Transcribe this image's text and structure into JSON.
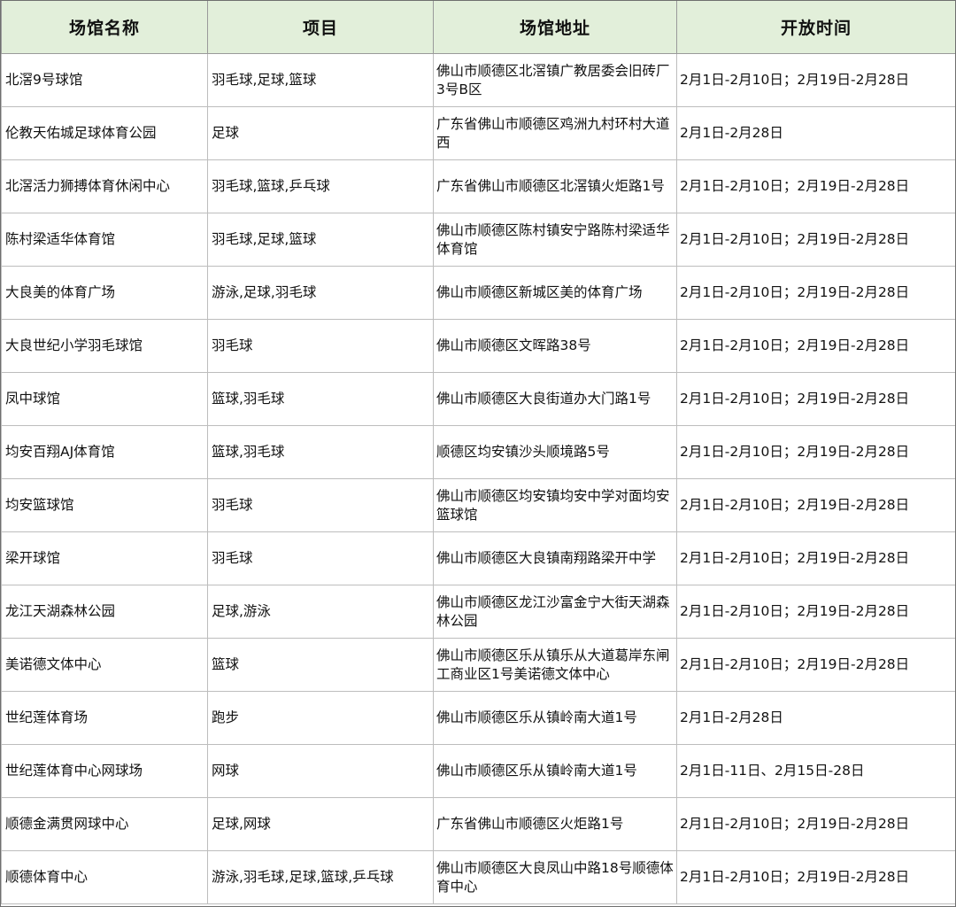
{
  "header": {
    "name": "场馆名称",
    "sport": "项目",
    "address": "场馆地址",
    "hours": "开放时间"
  },
  "colors": {
    "header_bg": "#e2efda",
    "grid_line": "#bdbdbd"
  },
  "rows": [
    {
      "name": "北滘9号球馆",
      "sport": "羽毛球,足球,篮球",
      "address": "佛山市顺德区北滘镇广教居委会旧砖厂3号B区",
      "hours": "2月1日-2月10日；2月19日-2月28日"
    },
    {
      "name": "伦教天佑城足球体育公园",
      "sport": "足球",
      "address": "广东省佛山市顺德区鸡洲九村环村大道西",
      "hours": "2月1日-2月28日"
    },
    {
      "name": "北滘活力狮搏体育休闲中心",
      "sport": "羽毛球,篮球,乒乓球",
      "address": "广东省佛山市顺德区北滘镇火炬路1号",
      "hours": "2月1日-2月10日；2月19日-2月28日"
    },
    {
      "name": "陈村梁适华体育馆",
      "sport": "羽毛球,足球,篮球",
      "address": "佛山市顺德区陈村镇安宁路陈村梁适华体育馆",
      "hours": "2月1日-2月10日；2月19日-2月28日"
    },
    {
      "name": "大良美的体育广场",
      "sport": "游泳,足球,羽毛球",
      "address": "佛山市顺德区新城区美的体育广场",
      "hours": "2月1日-2月10日；2月19日-2月28日"
    },
    {
      "name": "大良世纪小学羽毛球馆",
      "sport": "羽毛球",
      "address": "佛山市顺德区文晖路38号",
      "hours": "2月1日-2月10日；2月19日-2月28日"
    },
    {
      "name": "凤中球馆",
      "sport": "篮球,羽毛球",
      "address": "佛山市顺德区大良街道办大门路1号",
      "hours": "2月1日-2月10日；2月19日-2月28日"
    },
    {
      "name": "均安百翔AJ体育馆",
      "sport": "篮球,羽毛球",
      "address": "顺德区均安镇沙头顺境路5号",
      "hours": "2月1日-2月10日；2月19日-2月28日"
    },
    {
      "name": "均安篮球馆",
      "sport": "羽毛球",
      "address": "佛山市顺德区均安镇均安中学对面均安篮球馆",
      "hours": "2月1日-2月10日；2月19日-2月28日"
    },
    {
      "name": "梁开球馆",
      "sport": "羽毛球",
      "address": "佛山市顺德区大良镇南翔路梁开中学",
      "hours": "2月1日-2月10日；2月19日-2月28日"
    },
    {
      "name": "龙江天湖森林公园",
      "sport": "足球,游泳",
      "address": "佛山市顺德区龙江沙富金宁大街天湖森林公园",
      "hours": "2月1日-2月10日；2月19日-2月28日"
    },
    {
      "name": "美诺德文体中心",
      "sport": "篮球",
      "address": "佛山市顺德区乐从镇乐从大道葛岸东闸工商业区1号美诺德文体中心",
      "hours": "2月1日-2月10日；2月19日-2月28日"
    },
    {
      "name": "世纪莲体育场",
      "sport": "跑步",
      "address": "佛山市顺德区乐从镇岭南大道1号",
      "hours": "2月1日-2月28日"
    },
    {
      "name": "世纪莲体育中心网球场",
      "sport": "网球",
      "address": "佛山市顺德区乐从镇岭南大道1号",
      "hours": "2月1日-11日、2月15日-28日"
    },
    {
      "name": "顺德金满贯网球中心",
      "sport": "足球,网球",
      "address": "广东省佛山市顺德区火炬路1号",
      "hours": "2月1日-2月10日；2月19日-2月28日"
    },
    {
      "name": "顺德体育中心",
      "sport": "游泳,羽毛球,足球,篮球,乒乓球",
      "address": "佛山市顺德区大良凤山中路18号顺德体育中心",
      "hours": "2月1日-2月10日；2月19日-2月28日"
    }
  ]
}
